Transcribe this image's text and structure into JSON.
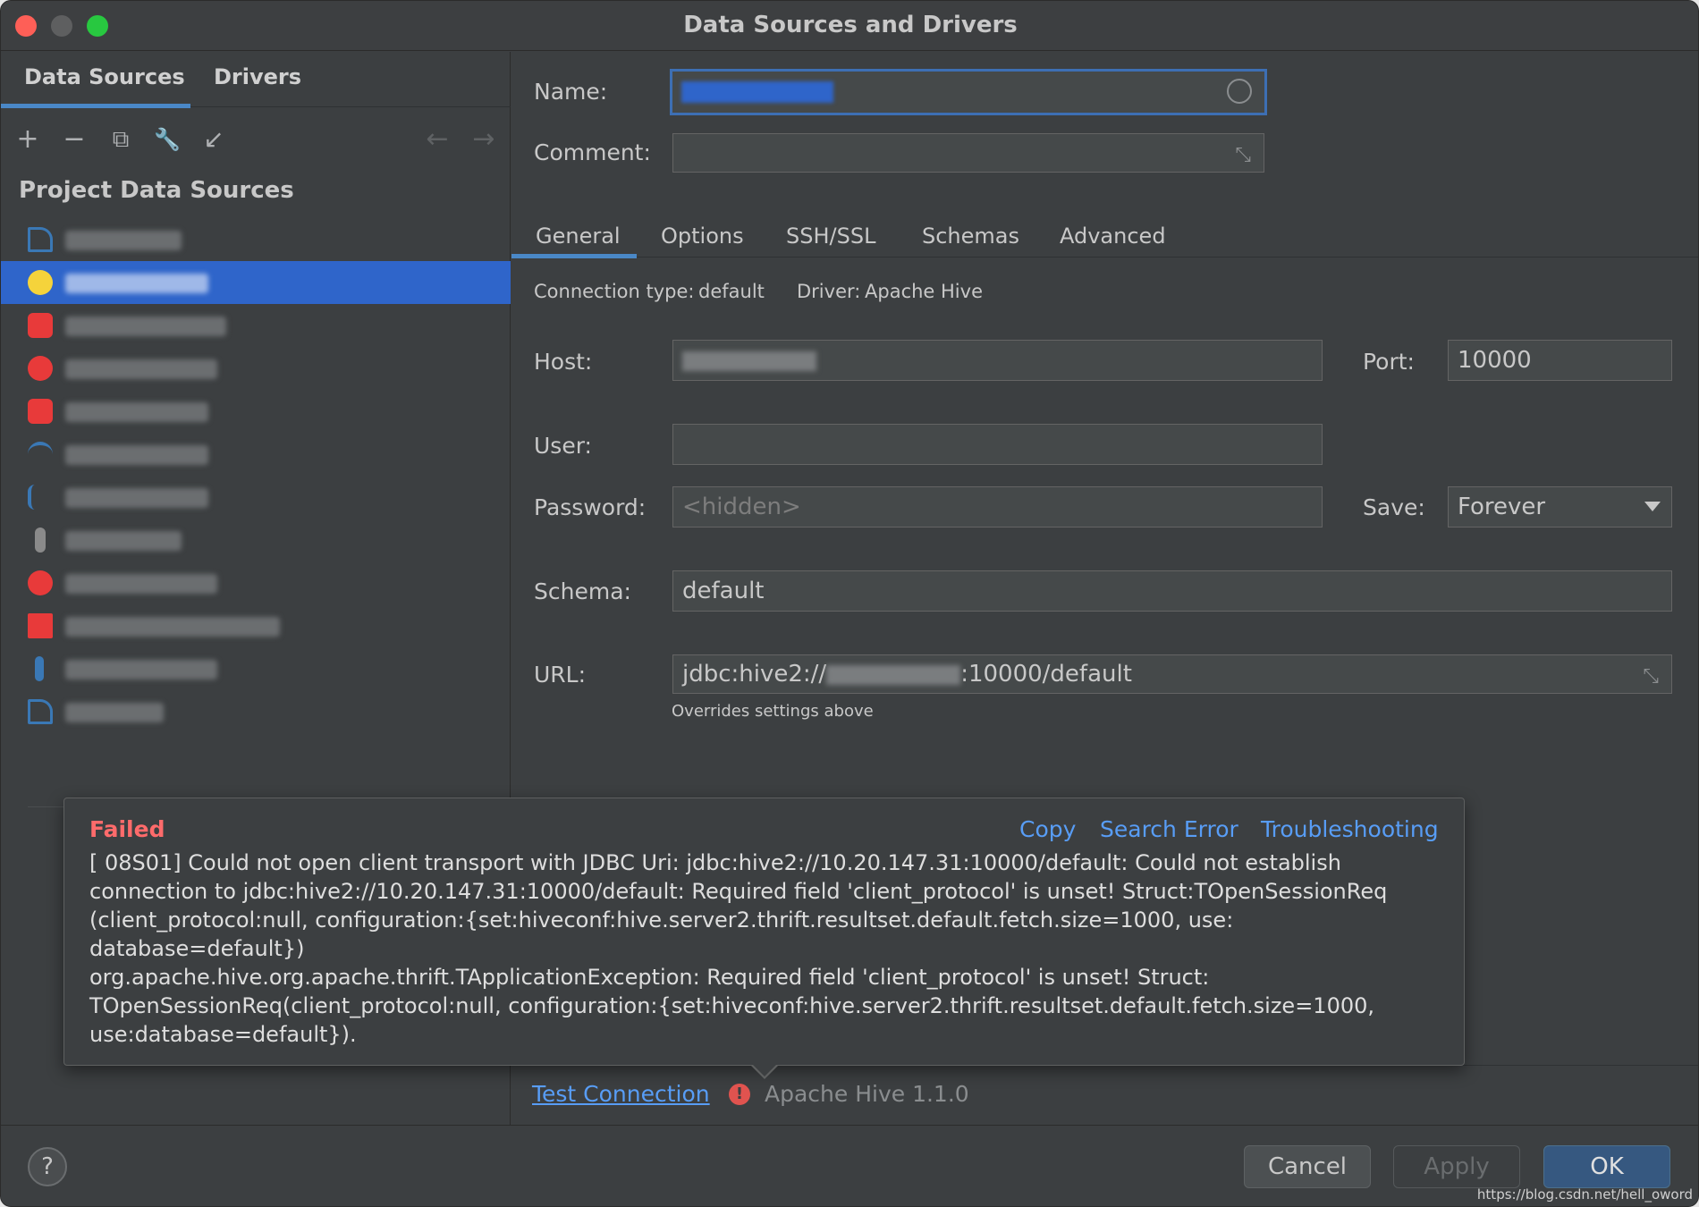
{
  "window": {
    "title": "Data Sources and Drivers"
  },
  "left": {
    "tabs": [
      "Data Sources",
      "Drivers"
    ],
    "toolbar": {
      "add": "+",
      "remove": "−",
      "copy": "⧉",
      "settings": "🔧",
      "import": "↙",
      "back": "←",
      "forward": "→"
    },
    "section_title": "Project Data Sources",
    "items": [
      {
        "icon": "mysql-icon",
        "color": "#3a78b5",
        "selected": false
      },
      {
        "icon": "hive-icon",
        "color": "#f5d33b",
        "selected": true
      },
      {
        "icon": "oracle-icon",
        "color": "#e83a3a",
        "selected": false
      },
      {
        "icon": "oracle-icon",
        "color": "#e83a3a",
        "selected": false
      },
      {
        "icon": "oracle-icon",
        "color": "#e83a3a",
        "selected": false
      },
      {
        "icon": "mysql-icon",
        "color": "#3a78b5",
        "selected": false
      },
      {
        "icon": "mysql-icon",
        "color": "#3a78b5",
        "selected": false
      },
      {
        "icon": "db-icon",
        "color": "#8a8a8a",
        "selected": false
      },
      {
        "icon": "oracle-icon",
        "color": "#e83a3a",
        "selected": false
      },
      {
        "icon": "oracle-icon",
        "color": "#e83a3a",
        "selected": false
      },
      {
        "icon": "db-icon",
        "color": "#3a78b5",
        "selected": false
      },
      {
        "icon": "mysql-icon",
        "color": "#3a78b5",
        "selected": false
      }
    ]
  },
  "form": {
    "name_label": "Name:",
    "comment_label": "Comment:",
    "tabs": [
      "General",
      "Options",
      "SSH/SSL",
      "Schemas",
      "Advanced"
    ],
    "connection_type_label": "Connection type:",
    "connection_type_value": "default",
    "driver_label": "Driver:",
    "driver_value": "Apache Hive",
    "host_label": "Host:",
    "port_label": "Port:",
    "port_value": "10000",
    "user_label": "User:",
    "password_label": "Password:",
    "password_placeholder": "<hidden>",
    "save_label": "Save:",
    "save_value": "Forever",
    "schema_label": "Schema:",
    "schema_value": "default",
    "url_label": "URL:",
    "url_prefix": "jdbc:hive2://",
    "url_suffix": ":10000/default",
    "url_note": "Overrides settings above"
  },
  "error": {
    "status": "Failed",
    "links": [
      "Copy",
      "Search Error",
      "Troubleshooting"
    ],
    "message": "[ 08S01] Could not open client transport with JDBC Uri: jdbc:hive2://10.20.147.31:10000/default: Could not establish connection to jdbc:hive2://10.20.147.31:10000/default: Required field 'client_protocol' is unset! Struct:TOpenSessionReq (client_protocol:null, configuration:{set:hiveconf:hive.server2.thrift.resultset.default.fetch.size=1000, use: database=default})\norg.apache.hive.org.apache.thrift.TApplicationException: Required field 'client_protocol' is unset! Struct: TOpenSessionReq(client_protocol:null, configuration:{set:hiveconf:hive.server2.thrift.resultset.default.fetch.size=1000, use:database=default})."
  },
  "bottom": {
    "test_connection": "Test Connection",
    "driver_version": "Apache Hive 1.1.0"
  },
  "footer": {
    "help": "?",
    "cancel": "Cancel",
    "apply": "Apply",
    "ok": "OK",
    "watermark": "https://blog.csdn.net/hell_oword"
  }
}
